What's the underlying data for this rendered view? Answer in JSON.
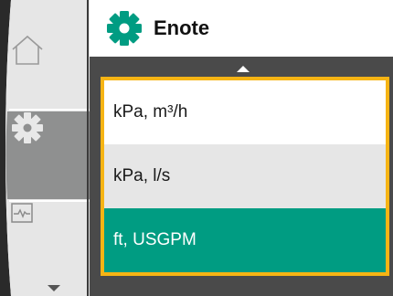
{
  "header": {
    "title": "Enote",
    "icon": "settings-gear-icon"
  },
  "sidebar": {
    "items": [
      {
        "name": "home",
        "icon": "home-icon",
        "selected": false
      },
      {
        "name": "settings",
        "icon": "gear-icon",
        "selected": true
      },
      {
        "name": "monitor",
        "icon": "pulse-monitor-icon",
        "selected": false
      }
    ],
    "scroll_down_icon": "triangle-down-icon"
  },
  "menu": {
    "scroll_up_icon": "triangle-up-icon",
    "options": [
      {
        "label": "kPa, m³/h"
      },
      {
        "label": "kPa, l/s"
      },
      {
        "label": "ft, USGPM"
      }
    ],
    "selected_index": 2
  },
  "colors": {
    "accent": "#009c82",
    "focus_border": "#f6b414",
    "panel_dark": "#4a4a4a",
    "sidebar_selected": "#8f9090"
  }
}
